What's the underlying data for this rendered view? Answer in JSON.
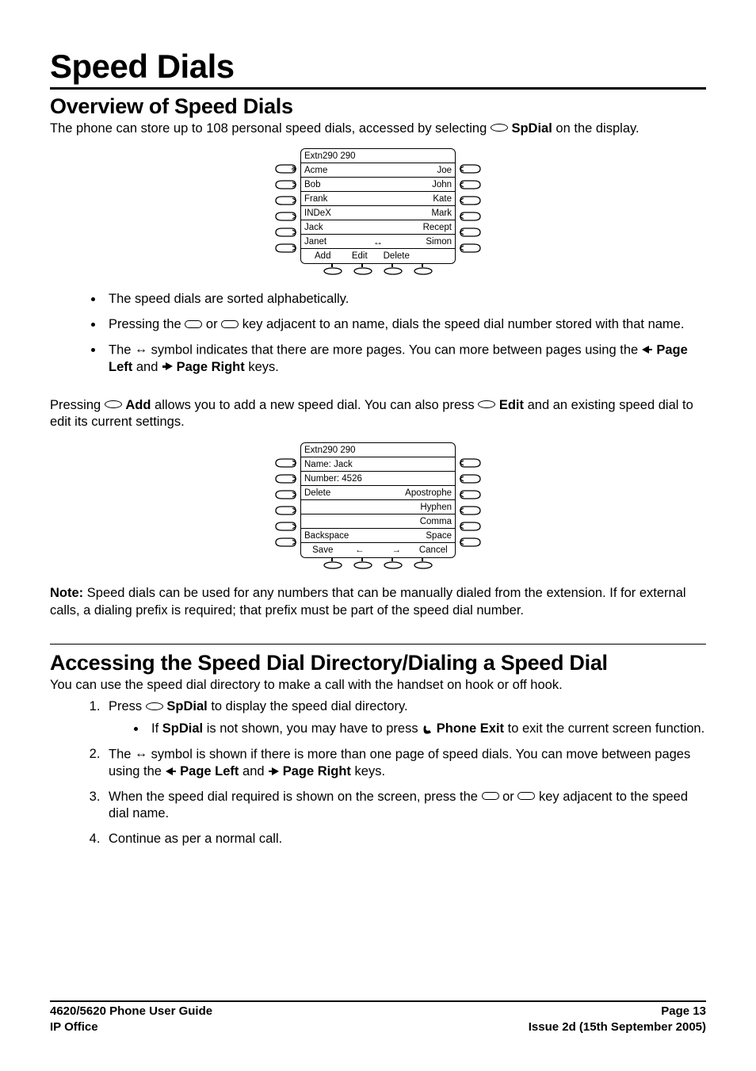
{
  "title": "Speed Dials",
  "section1": {
    "heading": "Overview of Speed Dials",
    "intro_pre": "The phone can store up to 108 personal speed dials, accessed by selecting ",
    "intro_bold": "SpDial",
    "intro_post": " on the display.",
    "bullets": {
      "b1": "The speed dials are sorted alphabetically.",
      "b2_pre": "Pressing the ",
      "b2_mid": " or ",
      "b2_post": " key adjacent to an name, dials the speed dial number stored with that name.",
      "b3_pre": "The ",
      "b3_mid": " symbol indicates that there are more pages. You can more between pages using the ",
      "b3_pl": "Page Left",
      "b3_and": " and ",
      "b3_pr": "Page Right",
      "b3_post": " keys."
    },
    "para2_pre": "Pressing ",
    "para2_add": "Add",
    "para2_mid": " allows you to add a new speed dial. You can also press ",
    "para2_edit": "Edit",
    "para2_post": " and an existing speed dial to edit its current settings.",
    "note_label": "Note:",
    "note_text": " Speed dials can be used for any numbers that can be manually dialed from the extension. If for external calls, a dialing prefix is required; that prefix must be part of the speed dial number."
  },
  "diagram1": {
    "header": "Extn290 290",
    "rows": [
      {
        "l": "Acme",
        "r": "Joe"
      },
      {
        "l": "Bob",
        "r": "John"
      },
      {
        "l": "Frank",
        "r": "Kate"
      },
      {
        "l": "INDeX",
        "r": "Mark"
      },
      {
        "l": "Jack",
        "r": "Recept"
      },
      {
        "l": "Janet",
        "r": "Simon"
      }
    ],
    "softkeys": [
      "Add",
      "Edit",
      "Delete",
      ""
    ]
  },
  "diagram2": {
    "header": "Extn290 290",
    "rows": [
      {
        "l": "Name: Jack",
        "r": ""
      },
      {
        "l": "Number: 4526",
        "r": ""
      },
      {
        "l": "Delete",
        "r": "Apostrophe"
      },
      {
        "l": "",
        "r": "Hyphen"
      },
      {
        "l": "",
        "r": "Comma"
      },
      {
        "l": "Backspace",
        "r": "Space"
      }
    ],
    "softkeys": [
      "Save",
      "←",
      "→",
      "Cancel"
    ]
  },
  "section2": {
    "heading": "Accessing the Speed Dial Directory/Dialing a Speed Dial",
    "intro": "You can use the speed dial directory to make a call with the handset on hook or off hook.",
    "n1_pre": "Press ",
    "n1_bold": "SpDial",
    "n1_post": " to display the speed dial directory.",
    "sub1_pre": "If ",
    "sub1_b1": "SpDial",
    "sub1_mid": " is not shown, you may have to press ",
    "sub1_b2": "Phone Exit",
    "sub1_post": " to exit the current screen function.",
    "n2_pre": "The ",
    "n2_mid": " symbol is shown if there is more than one page of speed dials. You can move between pages using the ",
    "n2_pl": "Page Left",
    "n2_and": " and ",
    "n2_pr": "Page Right",
    "n2_post": " keys.",
    "n3_pre": "When the speed dial required is shown on the screen, press the ",
    "n3_or": " or ",
    "n3_post": " key adjacent to the speed dial name.",
    "n4": "Continue as per a normal call."
  },
  "footer": {
    "left1": "4620/5620 Phone User Guide",
    "right1": "Page 13",
    "left2": "IP Office",
    "right2": "Issue 2d (15th September 2005)"
  }
}
